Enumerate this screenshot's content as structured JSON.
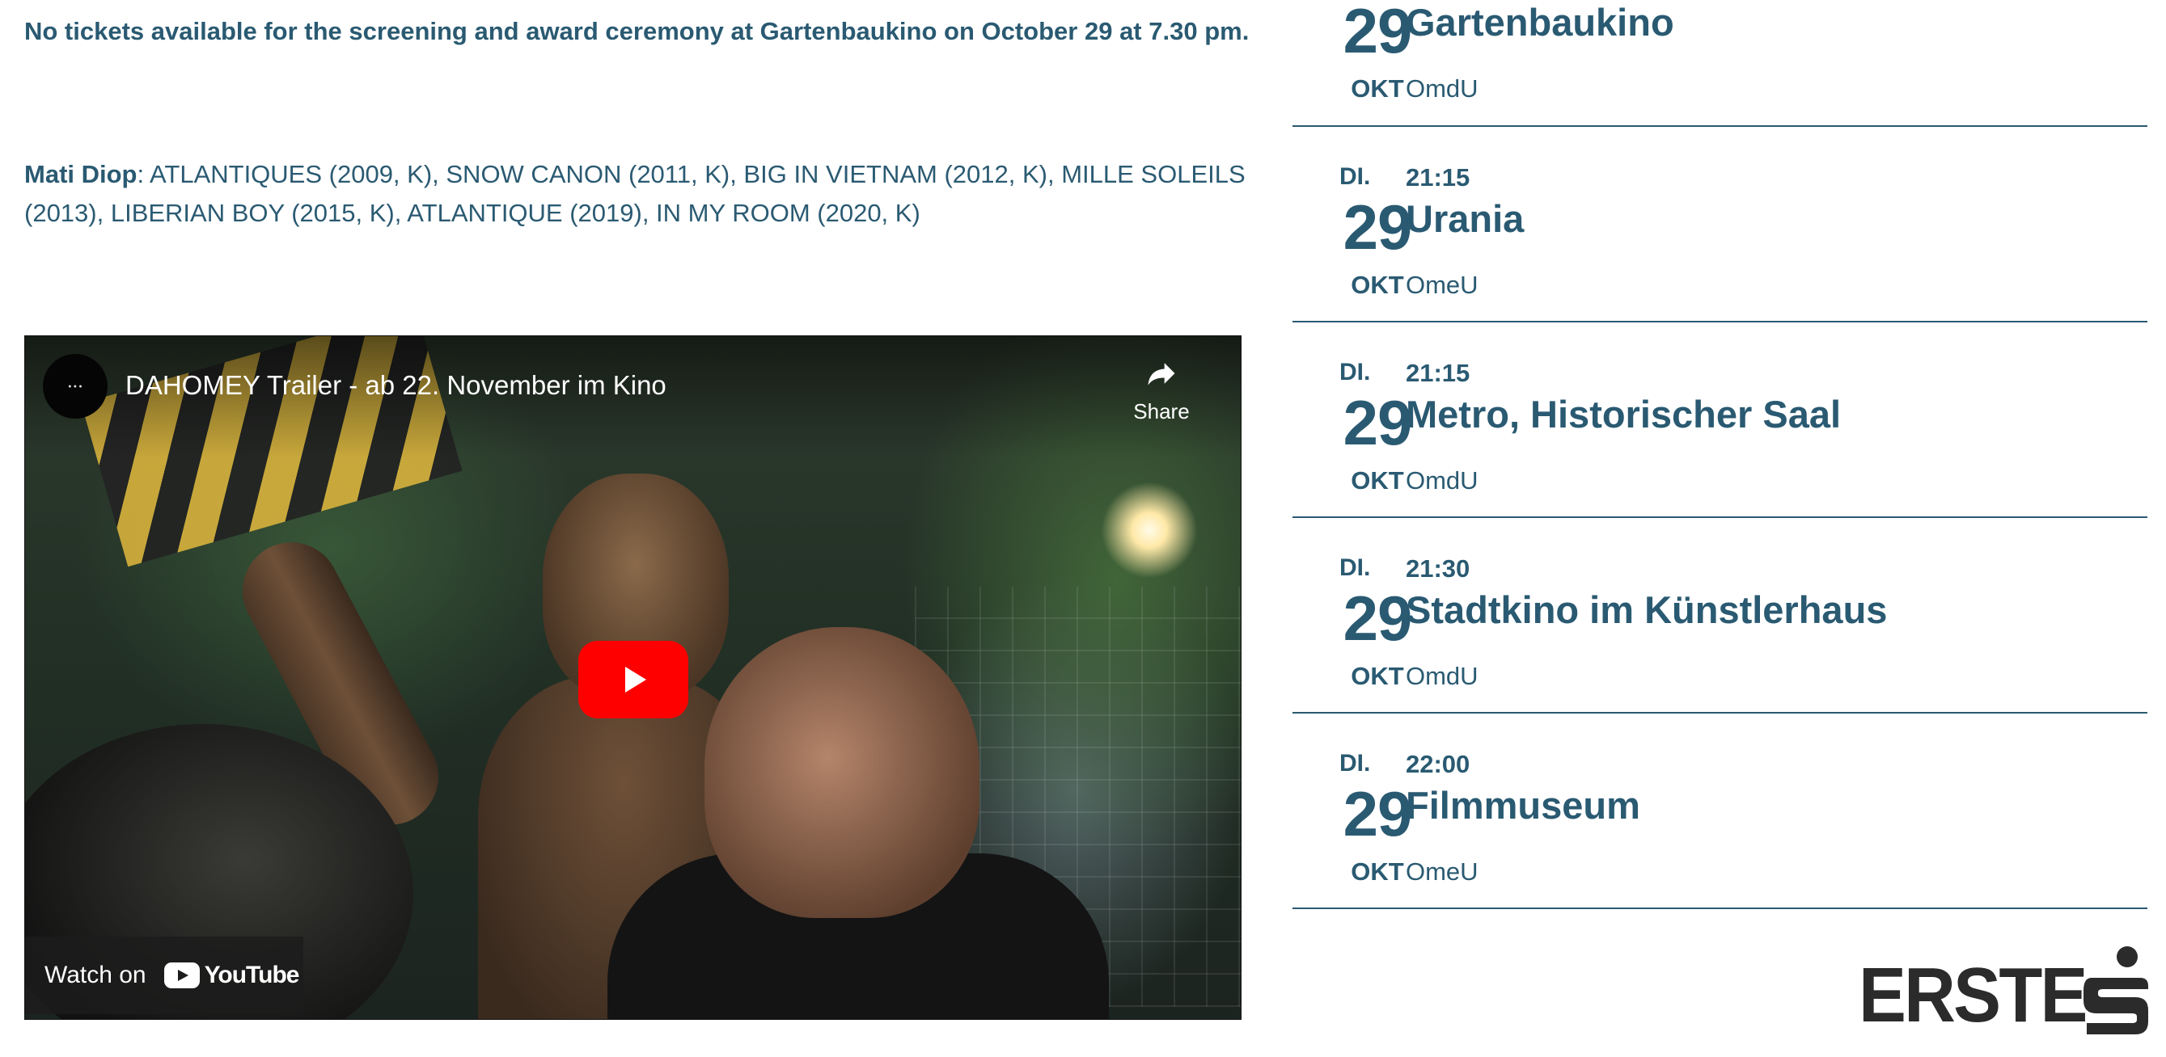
{
  "notice": "No tickets available for the screening and award ceremony at Gartenbaukino on October 29 at 7.30 pm.",
  "filmography": {
    "director": "Mati Diop",
    "films": ": ATLANTIQUES (2009, K), SNOW CANON (2011, K), BIG IN VIETNAM (2012, K), MILLE SOLEILS (2013), LIBERIAN BOY (2015, K), ATLANTIQUE (2019), IN MY ROOM (2020, K)"
  },
  "video": {
    "title": "DAHOMEY Trailer - ab 22. November im Kino",
    "channel_icon": "channel-avatar",
    "share_label": "Share",
    "share_icon": "share-arrow-icon",
    "play_icon": "youtube-play-icon",
    "watch_on_label": "Watch on",
    "youtube_wordmark": "YouTube",
    "play_color": "#ff0000"
  },
  "screenings": [
    {
      "weekday": "",
      "time": "",
      "day": "29",
      "month": "OKT",
      "venue": "Gartenbaukino",
      "version": "OmdU"
    },
    {
      "weekday": "DI.",
      "time": "21:15",
      "day": "29",
      "month": "OKT",
      "venue": "Urania",
      "version": "OmeU"
    },
    {
      "weekday": "DI.",
      "time": "21:15",
      "day": "29",
      "month": "OKT",
      "venue": "Metro, Historischer Saal",
      "version": "OmdU"
    },
    {
      "weekday": "DI.",
      "time": "21:30",
      "day": "29",
      "month": "OKT",
      "venue": "Stadtkino im Künstlerhaus",
      "version": "OmdU"
    },
    {
      "weekday": "DI.",
      "time": "22:00",
      "day": "29",
      "month": "OKT",
      "venue": "Filmmuseum",
      "version": "OmeU"
    }
  ],
  "sponsor": {
    "name": "ERSTE",
    "logo_icon": "erste-s-logo-icon"
  },
  "colors": {
    "text_primary": "#2a5a72",
    "logo": "#2b2b2b"
  }
}
